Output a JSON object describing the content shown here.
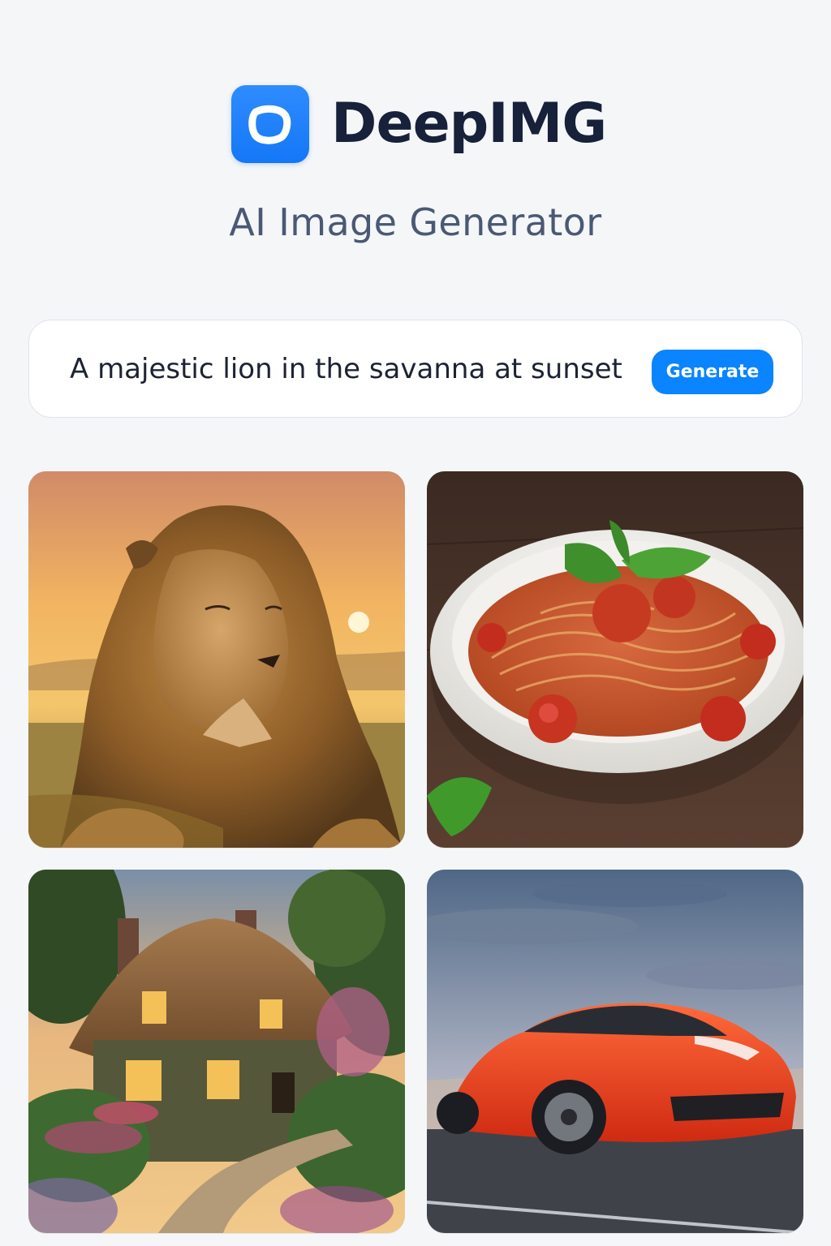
{
  "app": {
    "name": "DeepIMG",
    "tagline": "AI Image Generator",
    "logo_icon": "rounded-square-logo-icon",
    "accent_color": "#0a84ff"
  },
  "prompt": {
    "value": "A majestic lion in the savanna at sunset",
    "button_label": "Generate"
  },
  "gallery": {
    "images": [
      {
        "subject": "lion"
      },
      {
        "subject": "pasta"
      },
      {
        "subject": "cottage"
      },
      {
        "subject": "car"
      }
    ]
  }
}
